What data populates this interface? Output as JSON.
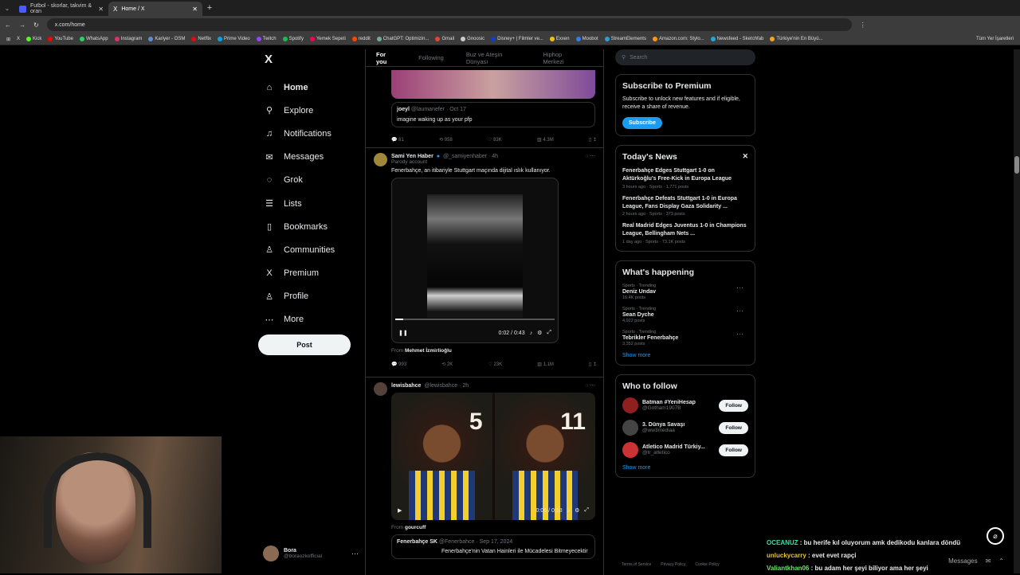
{
  "browser": {
    "tabs": [
      {
        "label": "Futbol - skorlar, takvim & oran"
      },
      {
        "label": "Home / X"
      }
    ],
    "url": "x.com/home",
    "bookmarks": [
      {
        "label": "Kick",
        "color": "#53fc18"
      },
      {
        "label": "YouTube",
        "color": "#ff0000"
      },
      {
        "label": "WhatsApp",
        "color": "#25d366"
      },
      {
        "label": "Instagram",
        "color": "#e1306c"
      },
      {
        "label": "Kariyer - OSM",
        "color": "#5a8fd4"
      },
      {
        "label": "Netflix",
        "color": "#e50914"
      },
      {
        "label": "Prime Video",
        "color": "#00a8e1"
      },
      {
        "label": "Twitch",
        "color": "#9146ff"
      },
      {
        "label": "Spotify",
        "color": "#1db954"
      },
      {
        "label": "Yemek Sepeti",
        "color": "#fa0050"
      },
      {
        "label": "reddit",
        "color": "#ff4500"
      },
      {
        "label": "ChatGPT: Optimizin...",
        "color": "#74aa9c"
      },
      {
        "label": "Gmail",
        "color": "#ea4335"
      },
      {
        "label": "Gnoosic",
        "color": "#cccccc"
      },
      {
        "label": "Disney+ | Filmler ve...",
        "color": "#113ccf"
      },
      {
        "label": "Exxen",
        "color": "#f4c20d"
      },
      {
        "label": "Moobot",
        "color": "#2f80ed"
      },
      {
        "label": "StreamElements",
        "color": "#2d9cdb"
      },
      {
        "label": "Amazon.com: Stylo...",
        "color": "#ff9900"
      },
      {
        "label": "Newsfeed - Sketchfab",
        "color": "#1caad9"
      },
      {
        "label": "Türkiye'nin En Büyü...",
        "color": "#f5a623"
      }
    ],
    "all_bookmarks": "Tüm Yer İşaretleri"
  },
  "nav": {
    "logo": "X",
    "items": [
      {
        "label": "Home",
        "icon": "home-icon",
        "glyph": "⌂"
      },
      {
        "label": "Explore",
        "icon": "search-icon",
        "glyph": "⚲"
      },
      {
        "label": "Notifications",
        "icon": "bell-icon",
        "glyph": "♫"
      },
      {
        "label": "Messages",
        "icon": "mail-icon",
        "glyph": "✉"
      },
      {
        "label": "Grok",
        "icon": "grok-icon",
        "glyph": "◌"
      },
      {
        "label": "Lists",
        "icon": "list-icon",
        "glyph": "☰"
      },
      {
        "label": "Bookmarks",
        "icon": "bookmark-icon",
        "glyph": "▯"
      },
      {
        "label": "Communities",
        "icon": "communities-icon",
        "glyph": "♙"
      },
      {
        "label": "Premium",
        "icon": "x-icon",
        "glyph": "X"
      },
      {
        "label": "Profile",
        "icon": "profile-icon",
        "glyph": "♙"
      },
      {
        "label": "More",
        "icon": "more-icon",
        "glyph": "⋯"
      }
    ],
    "post": "Post",
    "profile": {
      "name": "Bora",
      "handle": "@boraozkofficial",
      "more": "⋯"
    }
  },
  "feed": {
    "tabs": [
      "For you",
      "Following",
      "Buz ve Ateşin Dünyası",
      "Hiphop Merkezi"
    ],
    "quote1": {
      "name": "joeyl",
      "handle": "@laumanefer · Oct 17",
      "text": "imagine waking up as your pfp",
      "actions": [
        "81",
        "958",
        "83K",
        "4.3M"
      ]
    },
    "tweet2": {
      "name": "Sami Yen Haber",
      "handle": "@_samiyenhaber · 4h",
      "badge": "Parody account",
      "text": "Fenerbahçe, an itibariyle Stuttgart maçında dijital ıslık kullanıyor.",
      "time": "0:02 / 0:43",
      "from_label": "From",
      "from": "Mehmet İzmirlioğlu",
      "actions": [
        "993",
        "2K",
        "23K",
        "1.1M"
      ]
    },
    "tweet3": {
      "name": "lewisbahce",
      "handle": "@lewisbahce · 2h",
      "num1": "5",
      "num2": "11",
      "time": "0:05 / 0:18",
      "from_label": "From",
      "from": "gourcuff"
    },
    "quote2": {
      "name": "Fenerbahçe SK",
      "handle": "@Fenerbahce · Sep 17, 2024",
      "text": "Fenerbahçe'nin Vatan Hainleri ile Mücadelesi Bitmeyecektir"
    }
  },
  "sidebar": {
    "search": "Search",
    "premium": {
      "title": "Subscribe to Premium",
      "text": "Subscribe to unlock new features and if eligible, receive a share of revenue.",
      "button": "Subscribe"
    },
    "news": {
      "title": "Today's News",
      "items": [
        {
          "t": "Fenerbahçe Edges Stuttgart 1-0 on Aktürkoğlu's Free-Kick in Europa League",
          "m": "3 hours ago · Sports · 1,771 posts"
        },
        {
          "t": "Fenerbahçe Defeats Stuttgart 1-0 in Europa League, Fans Display Gaza Solidarity ...",
          "m": "2 hours ago · Sports · 373 posts"
        },
        {
          "t": "Real Madrid Edges Juventus 1-0 in Champions League, Bellingham Nets ...",
          "m": "1 day ago · Sports · 73.1K posts"
        }
      ]
    },
    "happening": {
      "title": "What's happening",
      "items": [
        {
          "c": "Sports · Trending",
          "n": "Deniz Undav",
          "p": "16.4K posts"
        },
        {
          "c": "Sports · Trending",
          "n": "Sean Dyche",
          "p": "4,922 posts"
        },
        {
          "c": "Sports · Trending",
          "n": "Tebrikler Fenerbahçe",
          "p": "3,352 posts"
        }
      ],
      "more": "Show more"
    },
    "follow": {
      "title": "Who to follow",
      "items": [
        {
          "n": "Batman #YeniHesap",
          "h": "@Gotham1907B",
          "color": "#8f2020"
        },
        {
          "n": "3. Dünya Savaşı",
          "h": "@ww3mediaa",
          "color": "#444444"
        },
        {
          "n": "Atletico Madrid Türkiy...",
          "h": "@tr_atletico",
          "color": "#cb3234"
        }
      ],
      "button": "Follow",
      "more": "Show more"
    },
    "footer": [
      "Terms of Service",
      "Privacy Policy",
      "Cookie Policy"
    ]
  },
  "chat": [
    {
      "user": "OCEANUZ",
      "color": "#36e3a6",
      "msg": "bu herife kıl oluyorum amk dedikodu kanlara döndü"
    },
    {
      "user": "unluckycarry",
      "color": "#e3c436",
      "msg": "evet evet rapçi"
    },
    {
      "user": "Valiantkhan06",
      "color": "#6fe36f",
      "msg": "bu adam her şeyi biliyor ama her şeyi"
    }
  ],
  "messages_label": "Messages"
}
